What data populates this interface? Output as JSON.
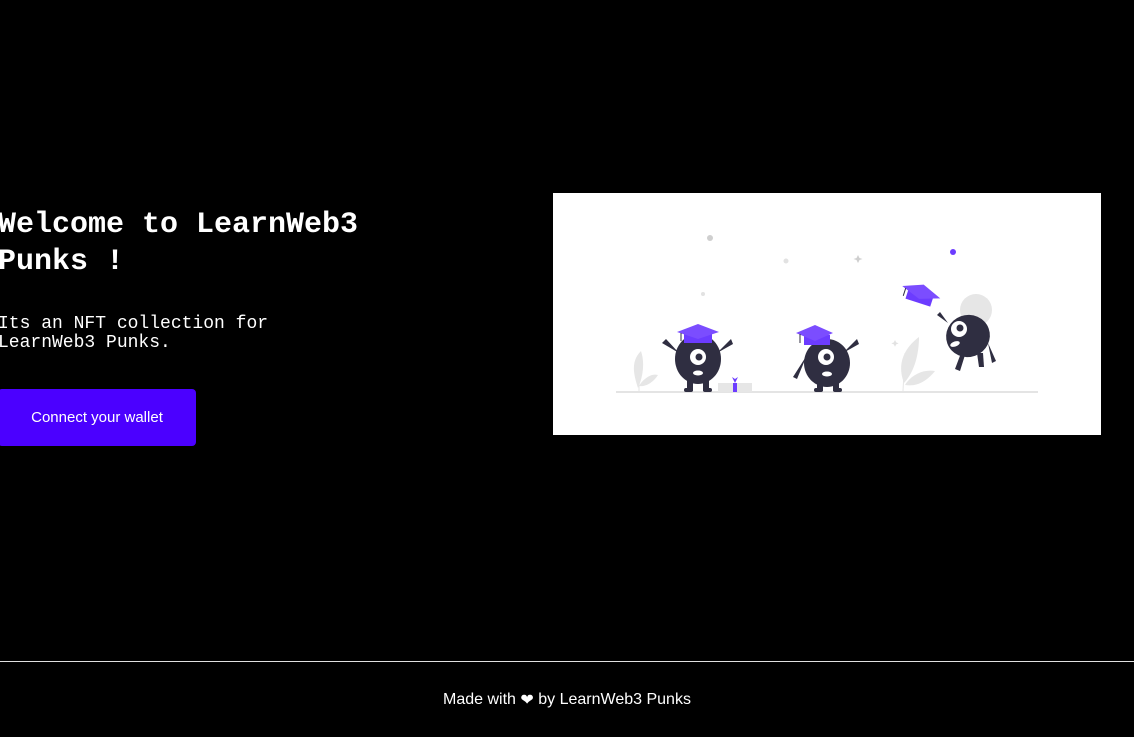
{
  "hero": {
    "title": "Welcome to LearnWeb3 Punks !",
    "description": "Its an NFT collection for LearnWeb3 Punks.",
    "connect_button_label": "Connect your wallet"
  },
  "illustration": {
    "icon": "graduation-monsters-illustration",
    "accent_color": "#6c3cff",
    "body_color": "#2f2e41"
  },
  "footer": {
    "prefix": "Made with ",
    "heart": "❤",
    "suffix": " by LearnWeb3 Punks"
  },
  "colors": {
    "background": "#000000",
    "button": "#4b00ff",
    "text": "#ffffff"
  }
}
